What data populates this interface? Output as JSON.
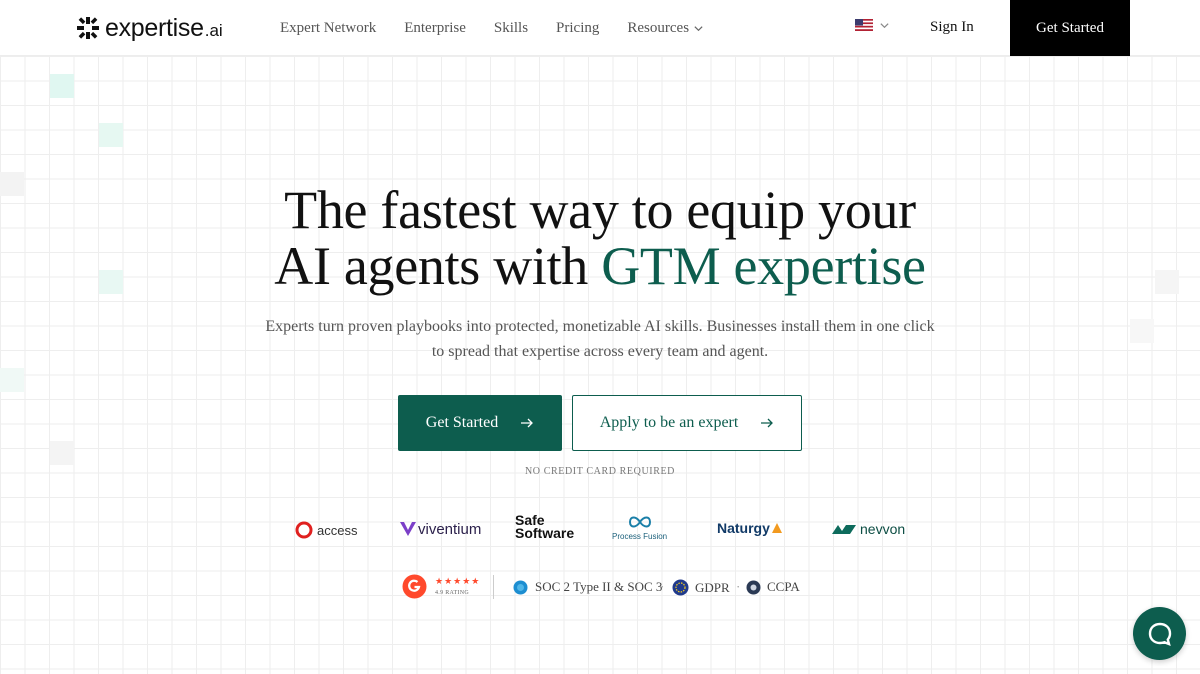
{
  "brand": {
    "name": "expertise",
    "suffix": ".ai",
    "accent_color": "#0d5d4e"
  },
  "nav": {
    "items": [
      {
        "label": "Expert Network"
      },
      {
        "label": "Enterprise"
      },
      {
        "label": "Skills"
      },
      {
        "label": "Pricing"
      },
      {
        "label": "Resources"
      }
    ],
    "locale_icon": "us-flag-icon",
    "sign_in": "Sign In",
    "cta": "Get Started"
  },
  "hero": {
    "line1": "The fastest way to equip your",
    "line2_plain": "AI agents with ",
    "line2_accent": "GTM expertise",
    "subtitle_line1": "Experts turn proven playbooks into protected, monetizable AI skills. Businesses install them in one click",
    "subtitle_line2": "to spread that expertise across every team and agent.",
    "primary_button": "Get Started",
    "secondary_button": "Apply to be an expert",
    "note": "NO CREDIT CARD REQUIRED"
  },
  "customer_logos": [
    {
      "name": "access"
    },
    {
      "name": "viventium"
    },
    {
      "name_line1": "Safe",
      "name_line2": "Software"
    },
    {
      "name": "Process Fusion"
    },
    {
      "name": "Naturgy"
    },
    {
      "name": "nevvon"
    }
  ],
  "trust": {
    "g2_stars": "★★★★★",
    "g2_rating": "4.9 RATING",
    "soc": "SOC 2 Type II & SOC 3",
    "gdpr": "GDPR",
    "ccpa": "CCPA",
    "separator": "·"
  }
}
